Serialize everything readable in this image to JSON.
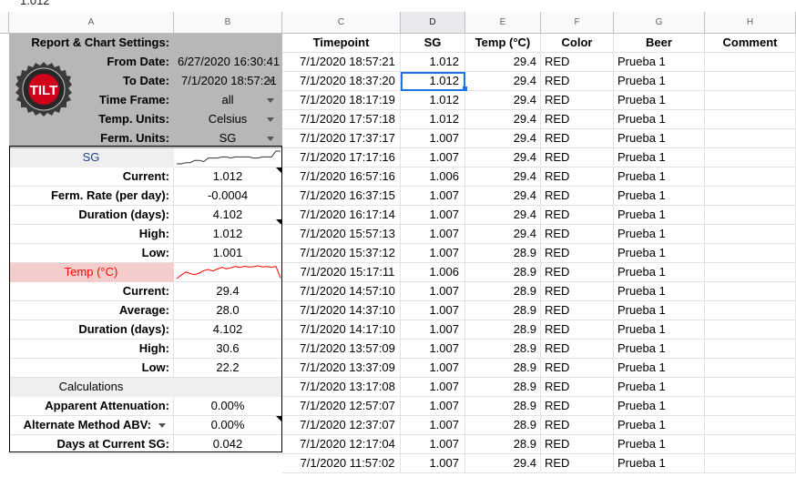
{
  "formula_bar_value": "1.012",
  "columns": [
    "A",
    "B",
    "C",
    "D",
    "E",
    "F",
    "G",
    "H"
  ],
  "settings": {
    "header": "Report & Chart Settings:",
    "from_date_label": "From Date:",
    "from_date": "6/27/2020 16:30:41",
    "to_date_label": "To Date:",
    "to_date": "7/1/2020 18:57:21",
    "time_frame_label": "Time Frame:",
    "time_frame": "all",
    "temp_units_label": "Temp. Units:",
    "temp_units": "Celsius",
    "ferm_units_label": "Ferm. Units:",
    "ferm_units": "SG",
    "logo_text": "TILT"
  },
  "sg_stats": {
    "title": "SG",
    "current_label": "Current:",
    "current": "1.012",
    "rate_label": "Ferm. Rate (per day):",
    "rate": "-0.0004",
    "duration_label": "Duration (days):",
    "duration": "4.102",
    "high_label": "High:",
    "high": "1.012",
    "low_label": "Low:",
    "low": "1.001",
    "sparkline": [
      1.001,
      1.001,
      1.002,
      1.002,
      1.004,
      1.004,
      1.003,
      1.006,
      1.006,
      1.006,
      1.007,
      1.007,
      1.006,
      1.007,
      1.007,
      1.007,
      1.007,
      1.006,
      1.006,
      1.007,
      1.007,
      1.007,
      1.012,
      1.012
    ]
  },
  "temp_stats": {
    "title": "Temp (°C)",
    "current_label": "Current:",
    "current": "29.4",
    "average_label": "Average:",
    "average": "28.0",
    "duration_label": "Duration (days):",
    "duration": "4.102",
    "high_label": "High:",
    "high": "30.6",
    "low_label": "Low:",
    "low": "22.2",
    "sparkline": [
      22.2,
      24.5,
      26.5,
      25.5,
      24.8,
      25.8,
      27.4,
      28.2,
      27.2,
      28.5,
      29.6,
      28.6,
      29.3,
      30.2,
      29.6,
      30.3,
      29.8,
      30.0,
      30.6,
      29.9,
      30.1,
      29.7,
      30.2,
      22.6
    ]
  },
  "calculations": {
    "title": "Calculations",
    "attenuation_label": "Apparent Attenuation:",
    "attenuation": "0.00%",
    "abv_label": "Alternate Method ABV:",
    "abv": "0.00%",
    "days_label": "Days at Current SG:",
    "days": "0.042"
  },
  "log_headers": {
    "timepoint": "Timepoint",
    "sg": "SG",
    "temp": "Temp (°C)",
    "color": "Color",
    "beer": "Beer",
    "comment": "Comment"
  },
  "log_rows": [
    [
      "7/1/2020 18:57:21",
      "1.012",
      "29.4",
      "RED",
      "Prueba 1"
    ],
    [
      "7/1/2020 18:37:20",
      "1.012",
      "29.4",
      "RED",
      "Prueba 1"
    ],
    [
      "7/1/2020 18:17:19",
      "1.012",
      "29.4",
      "RED",
      "Prueba 1"
    ],
    [
      "7/1/2020 17:57:18",
      "1.012",
      "29.4",
      "RED",
      "Prueba 1"
    ],
    [
      "7/1/2020 17:37:17",
      "1.007",
      "29.4",
      "RED",
      "Prueba 1"
    ],
    [
      "7/1/2020 17:17:16",
      "1.007",
      "29.4",
      "RED",
      "Prueba 1"
    ],
    [
      "7/1/2020 16:57:16",
      "1.006",
      "29.4",
      "RED",
      "Prueba 1"
    ],
    [
      "7/1/2020 16:37:15",
      "1.007",
      "29.4",
      "RED",
      "Prueba 1"
    ],
    [
      "7/1/2020 16:17:14",
      "1.007",
      "29.4",
      "RED",
      "Prueba 1"
    ],
    [
      "7/1/2020 15:57:13",
      "1.007",
      "29.4",
      "RED",
      "Prueba 1"
    ],
    [
      "7/1/2020 15:37:12",
      "1.007",
      "28.9",
      "RED",
      "Prueba 1"
    ],
    [
      "7/1/2020 15:17:11",
      "1.006",
      "28.9",
      "RED",
      "Prueba 1"
    ],
    [
      "7/1/2020 14:57:10",
      "1.007",
      "28.9",
      "RED",
      "Prueba 1"
    ],
    [
      "7/1/2020 14:37:10",
      "1.007",
      "28.9",
      "RED",
      "Prueba 1"
    ],
    [
      "7/1/2020 14:17:10",
      "1.007",
      "28.9",
      "RED",
      "Prueba 1"
    ],
    [
      "7/1/2020 13:57:09",
      "1.007",
      "28.9",
      "RED",
      "Prueba 1"
    ],
    [
      "7/1/2020 13:37:09",
      "1.007",
      "28.9",
      "RED",
      "Prueba 1"
    ],
    [
      "7/1/2020 13:17:08",
      "1.007",
      "28.9",
      "RED",
      "Prueba 1"
    ],
    [
      "7/1/2020 12:57:07",
      "1.007",
      "28.9",
      "RED",
      "Prueba 1"
    ],
    [
      "7/1/2020 12:37:07",
      "1.007",
      "28.9",
      "RED",
      "Prueba 1"
    ],
    [
      "7/1/2020 12:17:04",
      "1.007",
      "28.9",
      "RED",
      "Prueba 1"
    ],
    [
      "7/1/2020 11:57:02",
      "1.007",
      "29.4",
      "RED",
      "Prueba 1"
    ]
  ],
  "colors": {
    "sg_title": "#1c4587",
    "temp_title": "#ff0000",
    "selection": "#1a73e8"
  }
}
